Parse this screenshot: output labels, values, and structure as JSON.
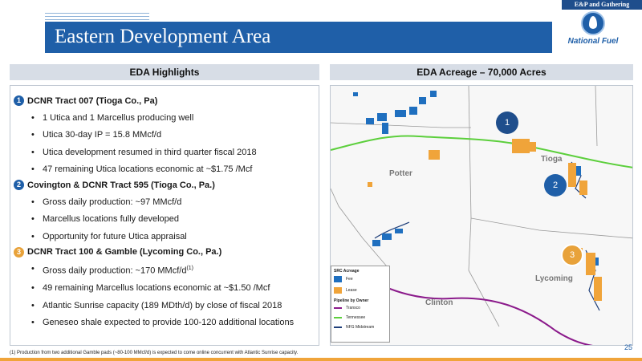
{
  "header": {
    "tag": "E&P and Gathering",
    "title": "Eastern Development Area",
    "logo_text": "National Fuel"
  },
  "left": {
    "heading": "EDA Highlights",
    "sections": [
      {
        "badge": "1",
        "title": "DCNR Tract 007 (Tioga Co., Pa)",
        "bullets": [
          "1 Utica and 1 Marcellus producing well",
          "Utica 30-day IP = 15.8 MMcf/d",
          "Utica development resumed in third quarter fiscal 2018",
          "47 remaining Utica locations economic at ~$1.75 /Mcf"
        ]
      },
      {
        "badge": "2",
        "title": "Covington & DCNR Tract 595 (Tioga Co., Pa.)",
        "bullets": [
          "Gross daily production: ~97 MMcf/d",
          "Marcellus locations fully developed",
          "Opportunity for future Utica appraisal"
        ]
      },
      {
        "badge": "3",
        "title": "DCNR Tract 100 & Gamble (Lycoming Co., Pa.)",
        "bullet_first": "Gross daily production: ~170 MMcf/d",
        "bullet_first_sup": "(1)",
        "bullets": [
          "49 remaining Marcellus locations economic at ~$1.50 /Mcf",
          "Atlantic Sunrise capacity (189 MDth/d) by close of fiscal 2018",
          "Geneseo shale expected to provide 100-120 additional locations"
        ]
      }
    ]
  },
  "right": {
    "heading": "EDA Acreage – 70,000 Acres",
    "pins": [
      "1",
      "2",
      "3"
    ],
    "counties": [
      "Potter",
      "Tioga",
      "Lycoming",
      "Clinton"
    ],
    "legend": {
      "acreage_title": "SRC Acreage",
      "fee": "Fee",
      "lease": "Lease",
      "pipeline_title": "Pipeline by Owner",
      "transco": "Transco",
      "tennessee": "Tennessee",
      "nfg": "NFG Midstream"
    },
    "colors": {
      "fee": "#1f6fbf",
      "lease": "#f0a43a",
      "transco": "#8b1a8b",
      "tennessee": "#5ccf3c",
      "nfg": "#1f3f7a"
    }
  },
  "footnote": "(1) Production from two additional Gamble pads (~80-100 MMcf/d) is expected to come online concurrent with Atlantic Sunrise capacity.",
  "page_number": "25"
}
